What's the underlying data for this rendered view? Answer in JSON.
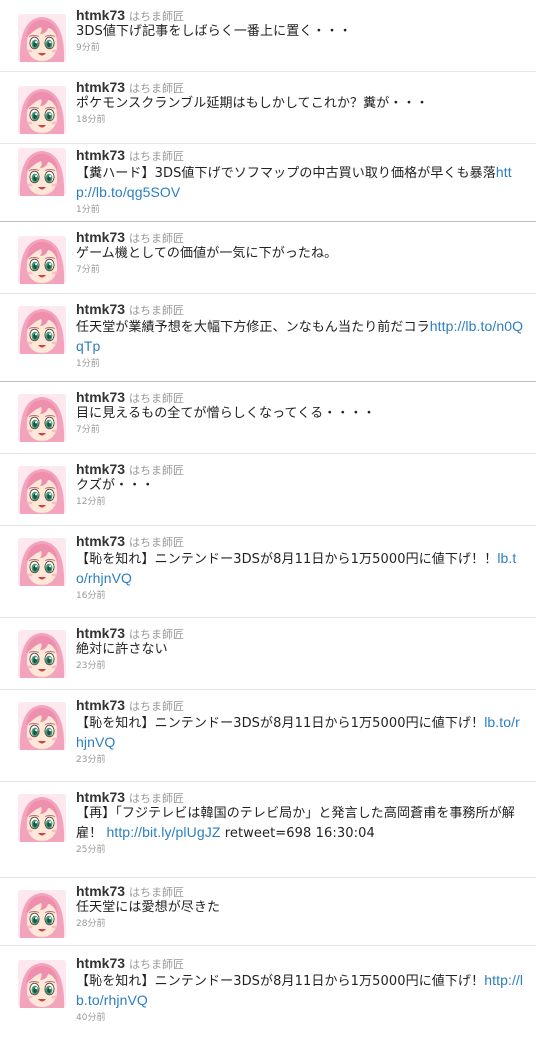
{
  "colors": {
    "link": "#2a7fc2",
    "name": "#333333",
    "muted": "#999999",
    "divider": "#e6e6e6",
    "section_divider": "#bdbdbd"
  },
  "tweets": [
    {
      "screen_name": "htmk73",
      "full_name": "はちま師匠",
      "text": "3DS値下げ記事をしばらく一番上に置く・・・",
      "link": "",
      "text_after": "",
      "time": "9分前",
      "avatar_icon": "anime-girl-avatar-icon"
    },
    {
      "screen_name": "htmk73",
      "full_name": "はちま師匠",
      "text": "ポケモンスクランブル延期はもしかしてこれか？糞が・・・",
      "link": "",
      "text_after": "",
      "time": "18分前",
      "avatar_icon": "anime-girl-avatar-icon"
    },
    {
      "screen_name": "htmk73",
      "full_name": "はちま師匠",
      "text": "【糞ハード】3DS値下げでソフマップの中古買い取り価格が早くも暴落",
      "link": "http://lb.to/qg5SOV",
      "text_after": "",
      "time": "1分前",
      "avatar_icon": "anime-girl-avatar-icon"
    },
    {
      "screen_name": "htmk73",
      "full_name": "はちま師匠",
      "text": "ゲーム機としての価値が一気に下がったね。",
      "link": "",
      "text_after": "",
      "time": "7分前",
      "avatar_icon": "anime-girl-avatar-icon"
    },
    {
      "screen_name": "htmk73",
      "full_name": "はちま師匠",
      "text": "任天堂が業績予想を大幅下方修正、ンなもん当たり前だコラ",
      "link": "http://lb.to/n0QqTp",
      "text_after": "",
      "time": "1分前",
      "avatar_icon": "anime-girl-avatar-icon"
    },
    {
      "screen_name": "htmk73",
      "full_name": "はちま師匠",
      "text": "目に見えるもの全てが憎らしくなってくる・・・・",
      "link": "",
      "text_after": "",
      "time": "7分前",
      "avatar_icon": "anime-girl-avatar-icon"
    },
    {
      "screen_name": "htmk73",
      "full_name": "はちま師匠",
      "text": "クズが・・・",
      "link": "",
      "text_after": "",
      "time": "12分前",
      "avatar_icon": "anime-girl-avatar-icon"
    },
    {
      "screen_name": "htmk73",
      "full_name": "はちま師匠",
      "text": "【恥を知れ】ニンテンドー3DSが8月11日から1万5000円に値下げ！！",
      "link": "lb.to/rhjnVQ",
      "text_after": "",
      "time": "16分前",
      "avatar_icon": "anime-girl-avatar-icon"
    },
    {
      "screen_name": "htmk73",
      "full_name": "はちま師匠",
      "text": "絶対に許さない",
      "link": "",
      "text_after": "",
      "time": "23分前",
      "avatar_icon": "anime-girl-avatar-icon"
    },
    {
      "screen_name": "htmk73",
      "full_name": "はちま師匠",
      "text": "【恥を知れ】ニンテンドー3DSが8月11日から1万5000円に値下げ！",
      "link": "lb.to/rhjnVQ",
      "text_after": "",
      "time": "23分前",
      "avatar_icon": "anime-girl-avatar-icon"
    },
    {
      "screen_name": "htmk73",
      "full_name": "はちま師匠",
      "text": "【再】「フジテレビは韓国のテレビ局か」と発言した高岡蒼甫を事務所が解雇！ ",
      "link": "http://bit.ly/plUgJZ",
      "text_after": " retweet=698 16:30:04",
      "time": "25分前",
      "avatar_icon": "anime-girl-avatar-icon"
    },
    {
      "screen_name": "htmk73",
      "full_name": "はちま師匠",
      "text": "任天堂には愛想が尽きた",
      "link": "",
      "text_after": "",
      "time": "28分前",
      "avatar_icon": "anime-girl-avatar-icon"
    },
    {
      "screen_name": "htmk73",
      "full_name": "はちま師匠",
      "text": "【恥を知れ】ニンテンドー3DSが8月11日から1万5000円に値下げ！",
      "link": "http://lb.to/rhjnVQ",
      "text_after": "",
      "time": "40分前",
      "avatar_icon": "anime-girl-avatar-icon"
    }
  ]
}
